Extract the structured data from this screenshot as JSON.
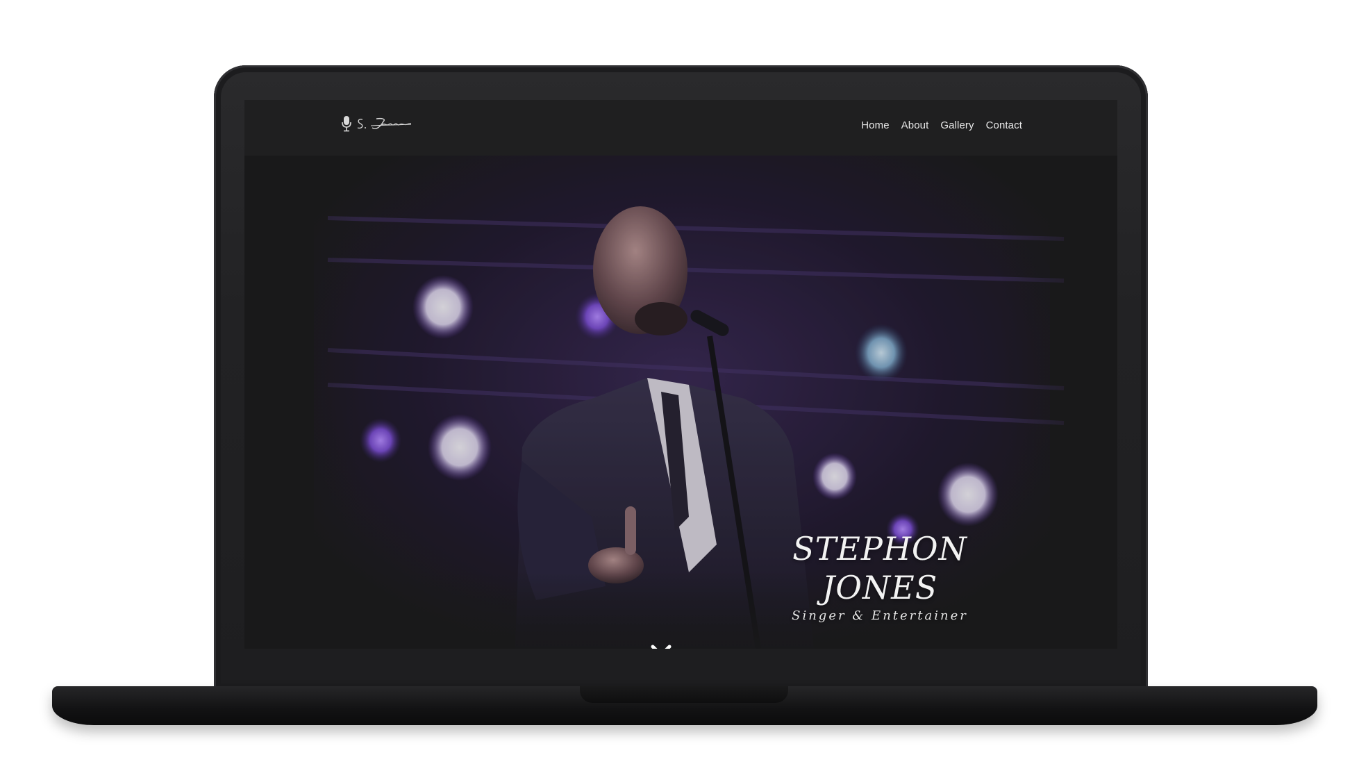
{
  "site": {
    "logo_text": "S. Jones",
    "nav": [
      {
        "label": "Home"
      },
      {
        "label": "About"
      },
      {
        "label": "Gallery"
      },
      {
        "label": "Contact"
      }
    ]
  },
  "hero": {
    "title_line1": "STEPHON",
    "title_line2": "JONES",
    "subtitle": "Singer & Entertainer",
    "scroll_icon": "chevron-down-icon"
  },
  "colors": {
    "stage_light_purple": "#7b4fd0",
    "stage_light_white": "#e8e2f0",
    "screen_bg": "#1d1d1e",
    "device_body": "#232325"
  }
}
